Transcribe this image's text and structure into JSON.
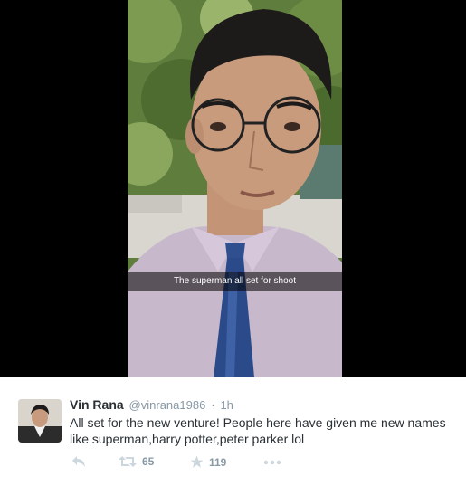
{
  "media": {
    "caption": "The superman all set for shoot"
  },
  "tweet": {
    "display_name": "Vin Rana",
    "handle": "@vinrana1986",
    "separator": "·",
    "time": "1h",
    "text": "All set for the new venture! People here have given me new names like superman,harry potter,peter parker lol",
    "actions": {
      "reply_icon": "reply-icon",
      "retweet_icon": "retweet-icon",
      "retweet_count": "65",
      "favorite_icon": "star-icon",
      "favorite_count": "119",
      "more_icon": "more-dots-icon"
    }
  },
  "colors": {
    "text": "#292f33",
    "muted": "#8899a6",
    "background": "#ffffff",
    "media_background": "#000000"
  }
}
